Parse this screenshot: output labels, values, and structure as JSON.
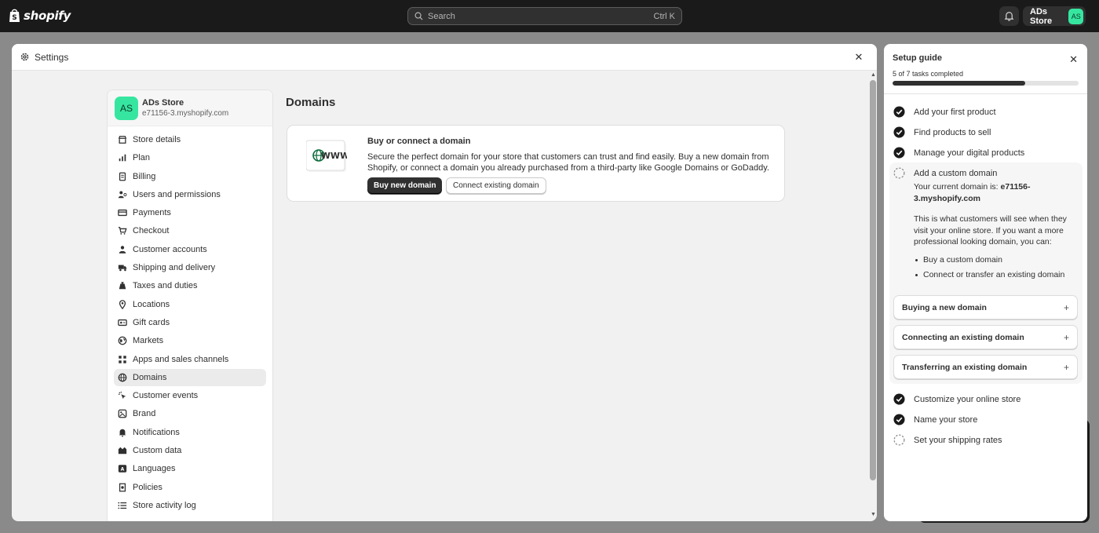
{
  "topbar": {
    "brand": "shopify",
    "search_placeholder": "Search",
    "search_shortcut": "Ctrl K",
    "store_name": "ADs Store",
    "store_initials": "AS"
  },
  "settings": {
    "title": "Settings",
    "store": {
      "name": "ADs Store",
      "initials": "AS",
      "domain": "e71156-3.myshopify.com"
    },
    "nav": [
      {
        "label": "Store details",
        "icon": "store-icon"
      },
      {
        "label": "Plan",
        "icon": "plan-icon"
      },
      {
        "label": "Billing",
        "icon": "billing-icon"
      },
      {
        "label": "Users and permissions",
        "icon": "users-icon"
      },
      {
        "label": "Payments",
        "icon": "payments-icon"
      },
      {
        "label": "Checkout",
        "icon": "cart-icon"
      },
      {
        "label": "Customer accounts",
        "icon": "person-icon"
      },
      {
        "label": "Shipping and delivery",
        "icon": "truck-icon"
      },
      {
        "label": "Taxes and duties",
        "icon": "tax-icon"
      },
      {
        "label": "Locations",
        "icon": "location-icon"
      },
      {
        "label": "Gift cards",
        "icon": "gift-card-icon"
      },
      {
        "label": "Markets",
        "icon": "globe-icon"
      },
      {
        "label": "Apps and sales channels",
        "icon": "apps-icon"
      },
      {
        "label": "Domains",
        "icon": "domain-globe-icon",
        "active": true
      },
      {
        "label": "Customer events",
        "icon": "cursor-icon"
      },
      {
        "label": "Brand",
        "icon": "brand-icon"
      },
      {
        "label": "Notifications",
        "icon": "bell-icon"
      },
      {
        "label": "Custom data",
        "icon": "database-icon"
      },
      {
        "label": "Languages",
        "icon": "language-icon"
      },
      {
        "label": "Policies",
        "icon": "policy-icon"
      },
      {
        "label": "Store activity log",
        "icon": "list-icon"
      }
    ],
    "main": {
      "title": "Domains",
      "card": {
        "illustration_text": "WWW",
        "title": "Buy or connect a domain",
        "description": "Secure the perfect domain for your store that customers can trust and find easily. Buy a new domain from Shopify, or connect a domain you already purchased from a third-party like Google Domains or GoDaddy.",
        "primary_button": "Buy new domain",
        "secondary_button": "Connect existing domain"
      }
    }
  },
  "guide": {
    "title": "Setup guide",
    "progress_text": "5 of 7 tasks completed",
    "progress_fraction": 0.714,
    "tasks": [
      {
        "label": "Add your first product",
        "done": true
      },
      {
        "label": "Find products to sell",
        "done": true
      },
      {
        "label": "Manage your digital products",
        "done": true
      },
      {
        "label": "Add a custom domain",
        "done": false
      },
      {
        "label": "Customize your online store",
        "done": true
      },
      {
        "label": "Name your store",
        "done": true
      },
      {
        "label": "Set your shipping rates",
        "done": false
      }
    ],
    "expanded": {
      "current_prefix": "Your current domain is: ",
      "current_domain_line1": "e71156-",
      "current_domain_line2": "3.myshopify.com",
      "info_line1": "This is what customers will see when they",
      "info_line2": "visit your online store. If you want a more",
      "info_line3": "professional looking domain, you can:",
      "bullets": [
        "Buy a custom domain",
        "Connect or transfer an existing domain"
      ],
      "accordions": [
        "Buying a new domain",
        "Connecting an existing domain",
        "Transferring an existing domain"
      ]
    }
  }
}
